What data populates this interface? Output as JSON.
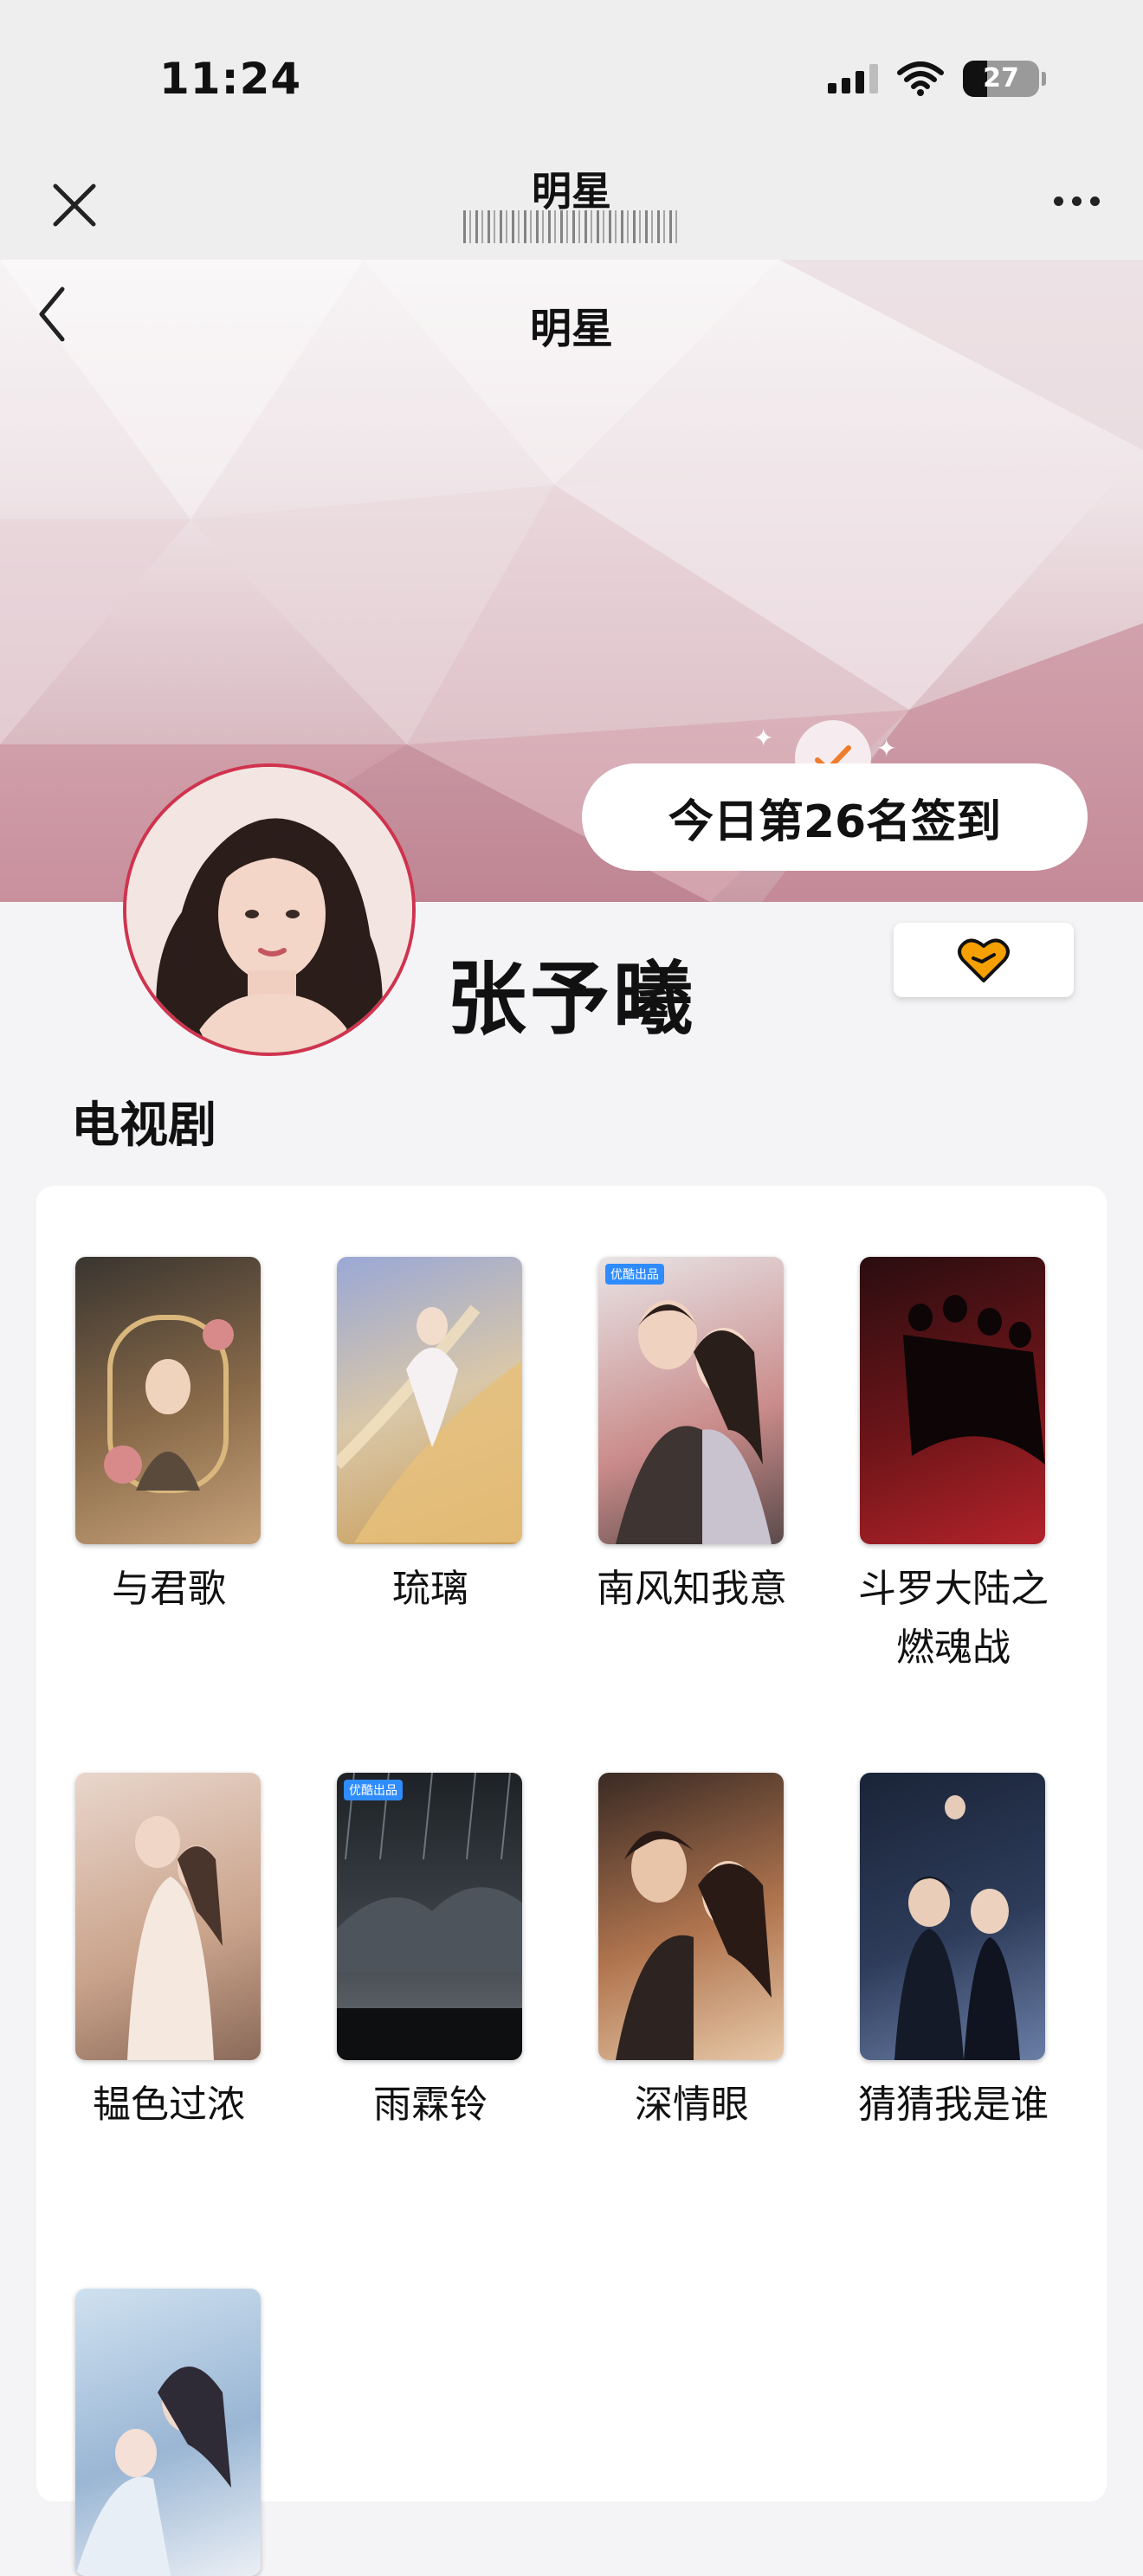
{
  "status_bar": {
    "time": "11:24",
    "battery": "27"
  },
  "mini_header": {
    "title": "明星"
  },
  "page": {
    "title": "明星"
  },
  "checkin": {
    "text": "今日第26名签到"
  },
  "profile": {
    "name": "张予曦"
  },
  "section": {
    "title": "电视剧"
  },
  "dramas": [
    {
      "title": "与君歌",
      "colors": [
        "#3a3530",
        "#8a6b4a",
        "#c7a27a"
      ]
    },
    {
      "title": "琉璃",
      "colors": [
        "#9aa8d6",
        "#d9c7a8",
        "#c89a54"
      ]
    },
    {
      "title": "南风知我意",
      "colors": [
        "#e8e4e6",
        "#c98b8a",
        "#5a4a4a"
      ]
    },
    {
      "title": "斗罗大陆之燃魂战",
      "colors": [
        "#2a0d10",
        "#6e1519",
        "#b3232a"
      ]
    },
    {
      "title": "韫色过浓",
      "colors": [
        "#e9d6cc",
        "#c9a28a",
        "#8a6a5a"
      ]
    },
    {
      "title": "雨霖铃",
      "colors": [
        "#1e2226",
        "#3c4248",
        "#6a7076"
      ]
    },
    {
      "title": "深情眼",
      "colors": [
        "#3a2a24",
        "#b0754f",
        "#e7c8a8"
      ]
    },
    {
      "title": "猜猜我是谁",
      "colors": [
        "#1a2438",
        "#2e3c5a",
        "#6a7ea6"
      ]
    },
    {
      "title": "",
      "colors": [
        "#cfe1f0",
        "#9ab6d4",
        "#ebeff5"
      ]
    }
  ],
  "colors": {
    "accent": "#f5a000",
    "avatar_border": "#d0334e"
  }
}
